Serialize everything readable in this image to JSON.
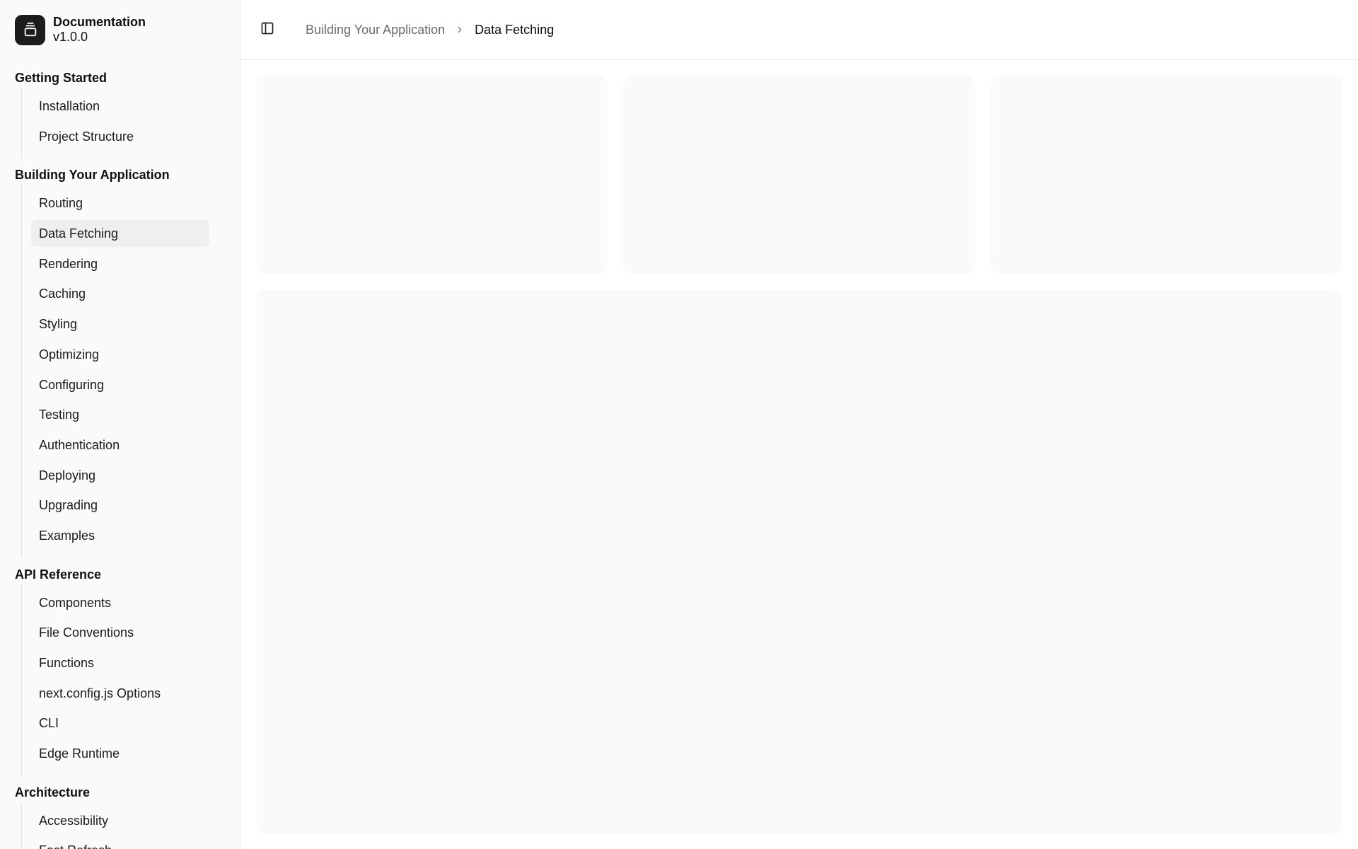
{
  "brand": {
    "title": "Documentation",
    "version": "v1.0.0",
    "logo_icon": "gallery-stack-icon"
  },
  "nav": {
    "groups": [
      {
        "label": "Getting Started",
        "items": [
          "Installation",
          "Project Structure"
        ]
      },
      {
        "label": "Building Your Application",
        "items": [
          "Routing",
          "Data Fetching",
          "Rendering",
          "Caching",
          "Styling",
          "Optimizing",
          "Configuring",
          "Testing",
          "Authentication",
          "Deploying",
          "Upgrading",
          "Examples"
        ]
      },
      {
        "label": "API Reference",
        "items": [
          "Components",
          "File Conventions",
          "Functions",
          "next.config.js Options",
          "CLI",
          "Edge Runtime"
        ]
      },
      {
        "label": "Architecture",
        "items": [
          "Accessibility",
          "Fast Refresh"
        ]
      }
    ],
    "active_item": "Data Fetching"
  },
  "topbar": {
    "toggle_icon": "sidebar-toggle-icon",
    "breadcrumb": {
      "parent": "Building Your Application",
      "separator_icon": "chevron-right-icon",
      "current": "Data Fetching"
    }
  },
  "colors": {
    "sidebar_bg": "#fafafa",
    "active_item_bg": "#efefef",
    "placeholder_bg": "#fafafa",
    "logo_bg": "#1c1c1c"
  }
}
